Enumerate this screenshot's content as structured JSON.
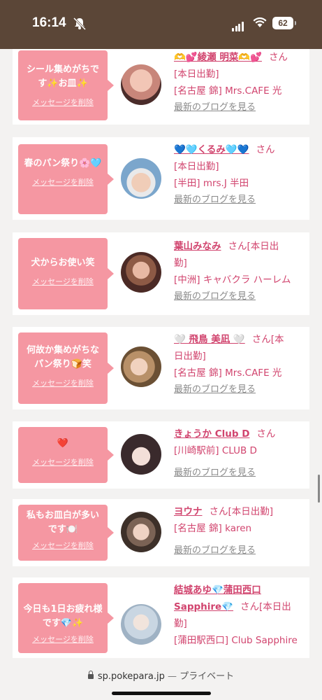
{
  "status": {
    "time": "16:14",
    "battery": "62"
  },
  "browser": {
    "url": "sp.pokepara.jp",
    "separator": "—",
    "mode": "プライベート"
  },
  "cards": [
    {
      "message": "シール集めがちです✨お皿✨",
      "delete_label": "メッセージを削除",
      "name": "🫶💕綾瀬 明菜🫶💕",
      "san": "さん",
      "line2": "[本日出勤]",
      "shop": "[名古屋 錦] Mrs.CAFE 光",
      "blog": "最新のブログを見る",
      "avatar_color": "#c8867a"
    },
    {
      "message": "春のパン祭り🌸🩵",
      "delete_label": "メッセージを削除",
      "name": "💙🩵くるみ🩵💙",
      "san": "さん",
      "line2": "[本日出勤]",
      "shop": "[半田] mrs.J 半田",
      "blog": "最新のブログを見る",
      "avatar_color": "#7ba6cc"
    },
    {
      "message": "犬からお使い笑",
      "delete_label": "メッセージを削除",
      "name": "葉山みなみ",
      "san": "さん[本日出",
      "line2": "勤]",
      "shop": "[中洲] キャバクラ ハーレム",
      "blog": "最新のブログを見る",
      "avatar_color": "#6b3f34"
    },
    {
      "message": "何故か集めがちなパン祭り🍞笑",
      "delete_label": "メッセージを削除",
      "name": "🤍 飛鳥 美凪 🤍",
      "san": "さん[本",
      "line2": "日出勤]",
      "shop": "[名古屋 錦] Mrs.CAFE 光",
      "blog": "最新のブログを見る",
      "avatar_color": "#a0784e"
    },
    {
      "message": "❤️",
      "delete_label": "メッセージを削除",
      "name": "きょうか Club D",
      "san": "さん",
      "line2": "",
      "shop": "[川崎駅前] CLUB D",
      "blog": "最新のブログを見る",
      "avatar_color": "#3a2a2c"
    },
    {
      "message": "私もお皿白が多いです🍽️",
      "delete_label": "メッセージを削除",
      "name": "ヨウナ",
      "san": "さん[本日出勤]",
      "line2": "",
      "shop": "[名古屋 錦] karen",
      "blog": "最新のブログを見る",
      "avatar_color": "#5a4a40"
    },
    {
      "message": "今日も1日お疲れ様です💎✨",
      "delete_label": "メッセージを削除",
      "name": "結城あゆ💎蒲田西口Sapphire💎",
      "san": "さん[本日出",
      "line2": "勤]",
      "shop": "[蒲田駅西口] Club Sapphire",
      "blog": "",
      "avatar_color": "#c9d6e2"
    }
  ]
}
